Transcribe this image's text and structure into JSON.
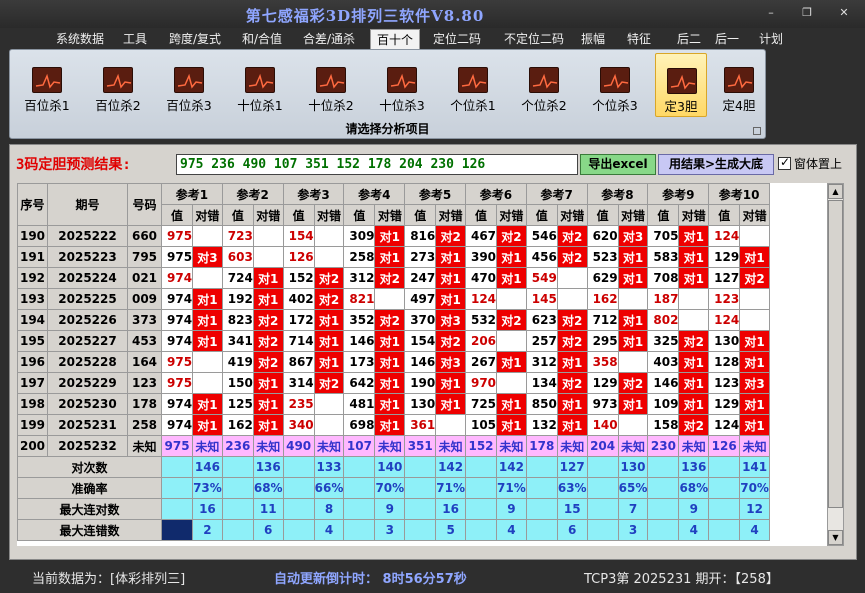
{
  "window": {
    "title": "第七感福彩3D排列三软件V8.80",
    "minimize": "–",
    "restore": "❐",
    "close": "✕"
  },
  "menu": [
    "系统数据",
    "工具",
    "跨度/复式",
    "和/合值",
    "合差/通杀",
    "百十个",
    "定位二码",
    "不定位二码",
    "振幅",
    "特征",
    "后二",
    "后一",
    "计划"
  ],
  "menu_active": 5,
  "ribbon": {
    "buttons": [
      "百位杀1",
      "百位杀2",
      "百位杀3",
      "十位杀1",
      "十位杀2",
      "十位杀3",
      "个位杀1",
      "个位杀2",
      "个位杀3",
      "定3胆",
      "定4胆"
    ],
    "active": 9,
    "caption": "请选择分析项目",
    "icon": "chart-line-icon"
  },
  "result": {
    "label": "3码定胆预测结果:",
    "value": "975 236 490 107 351 152 178 204 230 126",
    "export_label": "导出excel",
    "write_label": "用结果>生成大底",
    "ontop_label": "窗体置上",
    "ontop_checked": true
  },
  "grid": {
    "head_seq": "序号",
    "head_period": "期号",
    "head_num": "号码",
    "ref_headers": [
      "参考1",
      "参考2",
      "参考3",
      "参考4",
      "参考5",
      "参考6",
      "参考7",
      "参考8",
      "参考9",
      "参考10"
    ],
    "sub_val": "值",
    "sub_ok": "对错",
    "rows": [
      {
        "seq": "190",
        "period": "2025222",
        "num": "660",
        "cells": [
          [
            "975",
            "",
            1
          ],
          [
            "723",
            "",
            1
          ],
          [
            "154",
            "",
            1
          ],
          [
            "309",
            "对1",
            0
          ],
          [
            "816",
            "对2",
            0
          ],
          [
            "467",
            "对2",
            0
          ],
          [
            "546",
            "对2",
            0
          ],
          [
            "620",
            "对3",
            0
          ],
          [
            "705",
            "对1",
            0
          ],
          [
            "124",
            "",
            1
          ]
        ]
      },
      {
        "seq": "191",
        "period": "2025223",
        "num": "795",
        "cells": [
          [
            "975",
            "对3",
            0
          ],
          [
            "603",
            "",
            1
          ],
          [
            "126",
            "",
            1
          ],
          [
            "258",
            "对1",
            0
          ],
          [
            "273",
            "对1",
            0
          ],
          [
            "390",
            "对1",
            0
          ],
          [
            "456",
            "对2",
            0
          ],
          [
            "523",
            "对1",
            0
          ],
          [
            "583",
            "对1",
            0
          ],
          [
            "129",
            "对1",
            0
          ]
        ]
      },
      {
        "seq": "192",
        "period": "2025224",
        "num": "021",
        "cells": [
          [
            "974",
            "",
            1
          ],
          [
            "724",
            "对1",
            0
          ],
          [
            "152",
            "对2",
            0
          ],
          [
            "312",
            "对2",
            0
          ],
          [
            "247",
            "对1",
            0
          ],
          [
            "470",
            "对1",
            0
          ],
          [
            "549",
            "",
            1
          ],
          [
            "629",
            "对1",
            0
          ],
          [
            "708",
            "对1",
            0
          ],
          [
            "127",
            "对2",
            0
          ]
        ]
      },
      {
        "seq": "193",
        "period": "2025225",
        "num": "009",
        "cells": [
          [
            "974",
            "对1",
            0
          ],
          [
            "192",
            "对1",
            0
          ],
          [
            "402",
            "对2",
            0
          ],
          [
            "821",
            "",
            1
          ],
          [
            "497",
            "对1",
            0
          ],
          [
            "124",
            "",
            1
          ],
          [
            "145",
            "",
            1
          ],
          [
            "162",
            "",
            1
          ],
          [
            "187",
            "",
            1
          ],
          [
            "123",
            "",
            1
          ]
        ]
      },
      {
        "seq": "194",
        "period": "2025226",
        "num": "373",
        "cells": [
          [
            "974",
            "对1",
            0
          ],
          [
            "823",
            "对2",
            0
          ],
          [
            "172",
            "对1",
            0
          ],
          [
            "352",
            "对2",
            0
          ],
          [
            "370",
            "对3",
            0
          ],
          [
            "532",
            "对2",
            0
          ],
          [
            "623",
            "对2",
            0
          ],
          [
            "712",
            "对1",
            0
          ],
          [
            "802",
            "",
            1
          ],
          [
            "124",
            "",
            1
          ]
        ]
      },
      {
        "seq": "195",
        "period": "2025227",
        "num": "453",
        "cells": [
          [
            "974",
            "对1",
            0
          ],
          [
            "341",
            "对2",
            0
          ],
          [
            "714",
            "对1",
            0
          ],
          [
            "146",
            "对1",
            0
          ],
          [
            "154",
            "对2",
            0
          ],
          [
            "206",
            "",
            1
          ],
          [
            "257",
            "对2",
            0
          ],
          [
            "295",
            "对1",
            0
          ],
          [
            "325",
            "对2",
            0
          ],
          [
            "130",
            "对1",
            0
          ]
        ]
      },
      {
        "seq": "196",
        "period": "2025228",
        "num": "164",
        "cells": [
          [
            "975",
            "",
            1
          ],
          [
            "419",
            "对2",
            0
          ],
          [
            "867",
            "对1",
            0
          ],
          [
            "173",
            "对1",
            0
          ],
          [
            "146",
            "对3",
            0
          ],
          [
            "267",
            "对1",
            0
          ],
          [
            "312",
            "对1",
            0
          ],
          [
            "358",
            "",
            1
          ],
          [
            "403",
            "对1",
            0
          ],
          [
            "128",
            "对1",
            0
          ]
        ]
      },
      {
        "seq": "197",
        "period": "2025229",
        "num": "123",
        "cells": [
          [
            "975",
            "",
            1
          ],
          [
            "150",
            "对1",
            0
          ],
          [
            "314",
            "对2",
            0
          ],
          [
            "642",
            "对1",
            0
          ],
          [
            "190",
            "对1",
            0
          ],
          [
            "970",
            "",
            1
          ],
          [
            "134",
            "对2",
            0
          ],
          [
            "129",
            "对2",
            0
          ],
          [
            "146",
            "对1",
            0
          ],
          [
            "123",
            "对3",
            0
          ]
        ]
      },
      {
        "seq": "198",
        "period": "2025230",
        "num": "178",
        "cells": [
          [
            "974",
            "对1",
            0
          ],
          [
            "125",
            "对1",
            0
          ],
          [
            "235",
            "",
            1
          ],
          [
            "481",
            "对1",
            0
          ],
          [
            "130",
            "对1",
            0
          ],
          [
            "725",
            "对1",
            0
          ],
          [
            "850",
            "对1",
            0
          ],
          [
            "973",
            "对1",
            0
          ],
          [
            "109",
            "对1",
            0
          ],
          [
            "129",
            "对1",
            0
          ]
        ]
      },
      {
        "seq": "199",
        "period": "2025231",
        "num": "258",
        "cells": [
          [
            "974",
            "对1",
            0
          ],
          [
            "162",
            "对1",
            0
          ],
          [
            "340",
            "",
            1
          ],
          [
            "698",
            "对1",
            0
          ],
          [
            "361",
            "",
            1
          ],
          [
            "105",
            "对1",
            0
          ],
          [
            "132",
            "对1",
            0
          ],
          [
            "140",
            "",
            1
          ],
          [
            "158",
            "对2",
            0
          ],
          [
            "124",
            "对1",
            0
          ]
        ]
      }
    ],
    "pending_row": {
      "seq": "200",
      "period": "2025232",
      "num": "未知",
      "vals": [
        "975",
        "236",
        "490",
        "107",
        "351",
        "152",
        "178",
        "204",
        "230",
        "126"
      ],
      "ok": "未知"
    },
    "stats": [
      {
        "label": "对次数",
        "vals": [
          "146",
          "136",
          "133",
          "140",
          "142",
          "142",
          "127",
          "130",
          "136",
          "141"
        ]
      },
      {
        "label": "准确率",
        "vals": [
          "73%",
          "68%",
          "66%",
          "70%",
          "71%",
          "71%",
          "63%",
          "65%",
          "68%",
          "70%"
        ]
      },
      {
        "label": "最大连对数",
        "vals": [
          "16",
          "11",
          "8",
          "9",
          "16",
          "9",
          "15",
          "7",
          "9",
          "12"
        ]
      },
      {
        "label": "最大连错数",
        "vals": [
          "2",
          "6",
          "4",
          "3",
          "5",
          "4",
          "6",
          "3",
          "4",
          "4"
        ]
      }
    ]
  },
  "status": {
    "data_source": "当前数据为：[体彩排列三]",
    "countdown": "自动更新倒计时：  8时56分57秒",
    "period": "TCP3第 2025231 期开：【258】"
  }
}
